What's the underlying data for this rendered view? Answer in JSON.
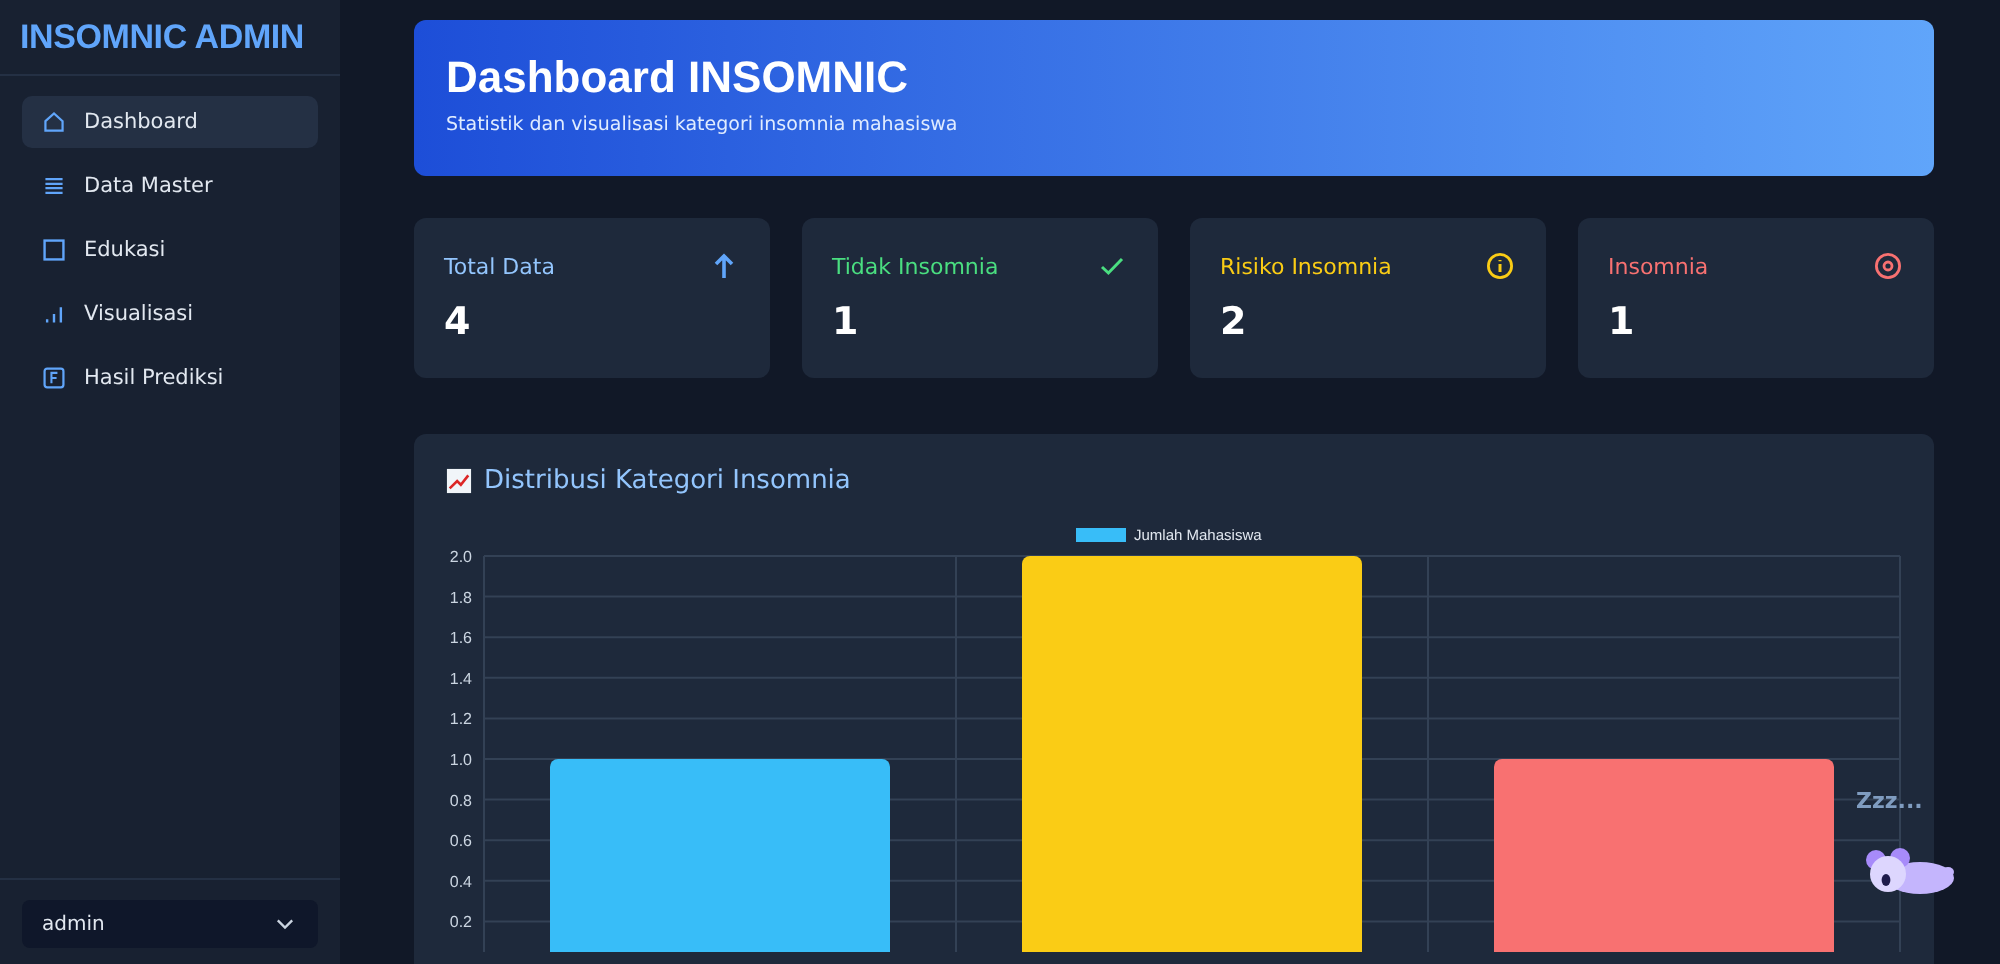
{
  "sidebar": {
    "title": "INSOMNIC ADMIN",
    "items": [
      {
        "label": "Dashboard",
        "kind": "home",
        "selected": true
      },
      {
        "label": "Data Master",
        "kind": "list",
        "selected": false
      },
      {
        "label": "Edukasi",
        "kind": "square",
        "selected": false
      },
      {
        "label": "Visualisasi",
        "kind": "bars",
        "selected": false
      },
      {
        "label": "Hasil Prediksi",
        "kind": "doc",
        "selected": false
      }
    ],
    "user_select": {
      "value": "admin"
    }
  },
  "header": {
    "title": "Dashboard INSOMNIC",
    "subtitle": "Statistik dan visualisasi kategori insomnia mahasiswa"
  },
  "stats": [
    {
      "label": "Total Data",
      "value": "4",
      "kind": "arrow",
      "color": "#93c5fd"
    },
    {
      "label": "Tidak Insomnia",
      "value": "1",
      "kind": "check",
      "color": "#4ade80"
    },
    {
      "label": "Risiko Insomnia",
      "value": "2",
      "kind": "info",
      "color": "#facc15"
    },
    {
      "label": "Insomnia",
      "value": "1",
      "kind": "target",
      "color": "#f87171"
    }
  ],
  "chart_panel": {
    "title": "Distribusi Kategori Insomnia",
    "chart_data": {
      "type": "bar",
      "grid": true,
      "series": [
        {
          "name": "Jumlah Mahasiswa",
          "color": "#38bdf8",
          "colors": [
            "#38bdf8",
            "#facc15",
            "#f87171"
          ],
          "values": [
            1,
            2,
            1
          ]
        }
      ],
      "ylim": [
        0,
        2
      ],
      "yticks": [
        {
          "value": 0.2,
          "label": "0.2"
        },
        {
          "value": 0.4,
          "label": "0.4"
        },
        {
          "value": 0.6,
          "label": "0.6"
        },
        {
          "value": 0.8,
          "label": "0.8"
        },
        {
          "value": 1,
          "label": "1.0"
        },
        {
          "value": 1.2,
          "label": "1.2"
        },
        {
          "value": 1.4,
          "label": "1.4"
        },
        {
          "value": 1.6,
          "label": "1.6"
        },
        {
          "value": 1.8,
          "label": "1.8"
        },
        {
          "value": 2,
          "label": "2.0"
        }
      ]
    }
  },
  "mascot": {
    "caption": "Zzz..."
  }
}
